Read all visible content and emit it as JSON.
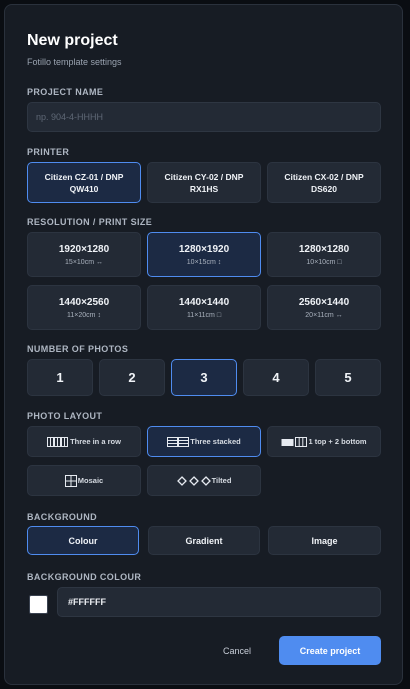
{
  "dialog": {
    "title": "New project",
    "subtitle": "Fotillo template settings"
  },
  "project_name": {
    "label": "PROJECT NAME",
    "placeholder": "np. 904-4-HHHH",
    "value": ""
  },
  "printer": {
    "label": "PRINTER",
    "options": [
      "Citizen CZ-01 / DNP QW410",
      "Citizen CY-02 / DNP RX1HS",
      "Citizen CX-02 / DNP DS620"
    ],
    "selected": 0
  },
  "resolution": {
    "label": "RESOLUTION / PRINT SIZE",
    "options": [
      {
        "size": "1920×1280",
        "note": "15×10cm ↔"
      },
      {
        "size": "1280×1920",
        "note": "10×15cm ↕"
      },
      {
        "size": "1280×1280",
        "note": "10×10cm □"
      },
      {
        "size": "1440×2560",
        "note": "11×20cm ↕"
      },
      {
        "size": "1440×1440",
        "note": "11×11cm □"
      },
      {
        "size": "2560×1440",
        "note": "20×11cm ↔"
      }
    ],
    "selected": 1
  },
  "photos": {
    "label": "NUMBER OF PHOTOS",
    "options": [
      "1",
      "2",
      "3",
      "4",
      "5"
    ],
    "selected": 2
  },
  "layout": {
    "label": "PHOTO LAYOUT",
    "options": [
      {
        "label": "Three in a row",
        "icon": "three-columns-icon"
      },
      {
        "label": "Three stacked",
        "icon": "three-stacked-icon"
      },
      {
        "label": "1 top + 2 bottom",
        "icon": "one-top-two-bottom-icon"
      },
      {
        "label": "Mosaic",
        "icon": "mosaic-icon"
      },
      {
        "label": "Tilted",
        "icon": "tilted-icon"
      }
    ],
    "selected": 1
  },
  "background": {
    "label": "BACKGROUND",
    "options": [
      "Colour",
      "Gradient",
      "Image"
    ],
    "selected": 0
  },
  "background_colour": {
    "label": "BACKGROUND COLOUR",
    "value": "#FFFFFF"
  },
  "actions": {
    "cancel": "Cancel",
    "create": "Create project"
  },
  "colors": {
    "accent": "#4f8cf0",
    "panel": "#171c24",
    "field": "#232a35",
    "selected_fill": "#1c2a44"
  }
}
